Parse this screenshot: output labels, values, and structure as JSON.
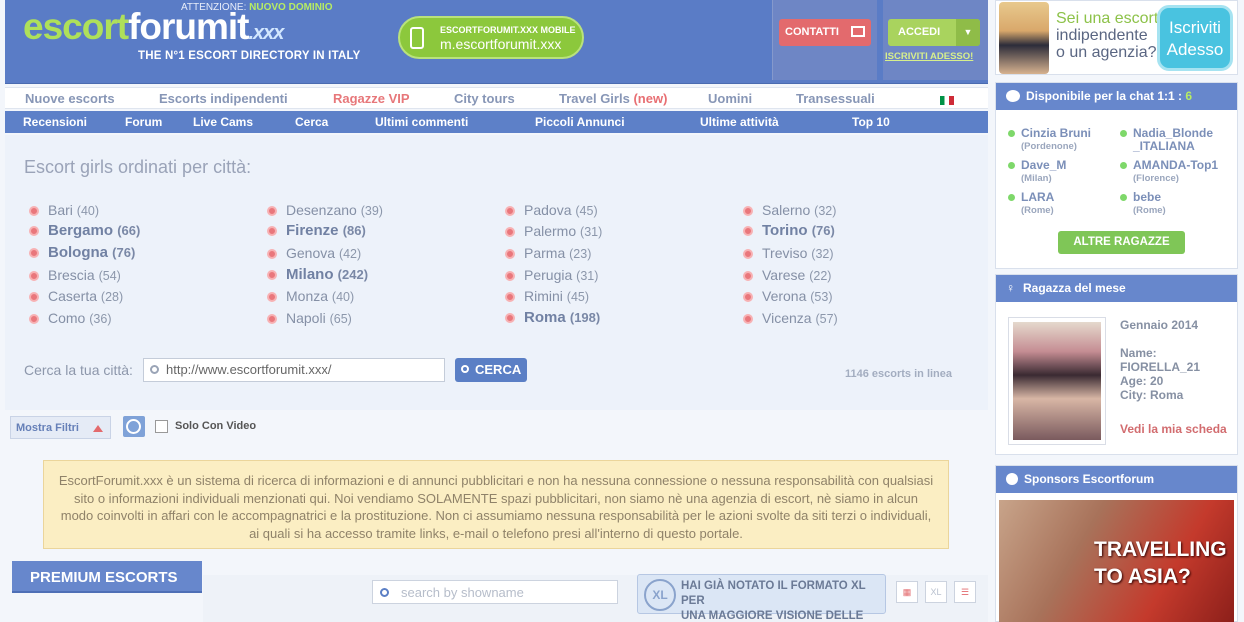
{
  "header": {
    "attention_prefix": "ATTENZIONE:",
    "attention_highlight": "NUOVO DOMINIO",
    "logo_part1": "escort",
    "logo_part2": "forumit",
    "logo_part3": ".xxx",
    "tagline": "THE N°1 ESCORT DIRECTORY IN ITALY",
    "mobile_line1": "ESCORTFORUMIT.XXX MOBILE",
    "mobile_line2": "m.escortforumit.xxx",
    "contatti": "CONTATTI",
    "accedi": "ACCEDI",
    "iscriviti": "ISCRIVITI ADESSO!"
  },
  "nav_primary": [
    {
      "label": "Nuove escorts"
    },
    {
      "label": "Escorts indipendenti"
    },
    {
      "label": "Ragazze VIP"
    },
    {
      "label": "City tours"
    },
    {
      "label": "Travel Girls",
      "badge": "(new)"
    },
    {
      "label": "Uomini"
    },
    {
      "label": "Transessuali"
    }
  ],
  "nav_secondary": [
    {
      "label": "Recensioni"
    },
    {
      "label": "Forum"
    },
    {
      "label": "Live Cams"
    },
    {
      "label": "Cerca"
    },
    {
      "label": "Ultimi commenti"
    },
    {
      "label": "Piccoli Annunci"
    },
    {
      "label": "Ultime attività"
    },
    {
      "label": "Top 10"
    }
  ],
  "cities_title": "Escort girls ordinati per città:",
  "cities": [
    {
      "name": "Bari",
      "count": "(40)"
    },
    {
      "name": "Bergamo",
      "count": "(66)"
    },
    {
      "name": "Bologna",
      "count": "(76)"
    },
    {
      "name": "Brescia",
      "count": "(54)"
    },
    {
      "name": "Caserta",
      "count": "(28)"
    },
    {
      "name": "Como",
      "count": "(36)"
    },
    {
      "name": "Desenzano",
      "count": "(39)"
    },
    {
      "name": "Firenze",
      "count": "(86)"
    },
    {
      "name": "Genova",
      "count": "(42)"
    },
    {
      "name": "Milano",
      "count": "(242)"
    },
    {
      "name": "Monza",
      "count": "(40)"
    },
    {
      "name": "Napoli",
      "count": "(65)"
    },
    {
      "name": "Padova",
      "count": "(45)"
    },
    {
      "name": "Palermo",
      "count": "(31)"
    },
    {
      "name": "Parma",
      "count": "(23)"
    },
    {
      "name": "Perugia",
      "count": "(31)"
    },
    {
      "name": "Rimini",
      "count": "(45)"
    },
    {
      "name": "Roma",
      "count": "(198)"
    },
    {
      "name": "Salerno",
      "count": "(32)"
    },
    {
      "name": "Torino",
      "count": "(76)"
    },
    {
      "name": "Treviso",
      "count": "(32)"
    },
    {
      "name": "Varese",
      "count": "(22)"
    },
    {
      "name": "Verona",
      "count": "(53)"
    },
    {
      "name": "Vicenza",
      "count": "(57)"
    }
  ],
  "search": {
    "label": "Cerca la tua città:",
    "value": "http://www.escortforumit.xxx/",
    "button": "CERCA",
    "online": "1146 escorts in linea"
  },
  "filters": {
    "label": "Mostra Filtri",
    "video_label": "Solo Con Video"
  },
  "disclaimer": "EscortForumit.xxx è un sistema di ricerca di informazioni e di annunci pubblicitari e non ha nessuna connessione o nessuna responsabilità con qualsiasi sito o informazioni individuali menzionati qui. Noi vendiamo SOLAMENTE spazi pubblicitari, non siamo nè una agenzia di escort, nè siamo in alcun modo coinvolti in affari con le accompagnatrici e la prostituzione. Non ci assumiamo nessuna responsabilità per le azioni svolte da siti terzi o individuali, ai quali si ha accesso tramite links, e-mail o telefono presi all'interno di questo portale.",
  "premium": {
    "title": "PREMIUM ESCORTS",
    "search_placeholder": "search by showname",
    "xl_badge": "XL",
    "xl_tip_line1": "HAI GIÀ NOTATO IL FORMATO XL PER",
    "xl_tip_line2": "UNA MAGGIORE VISIONE DELLE FOTO?",
    "xl_button": "XL"
  },
  "sidebar": {
    "promo_line1": "Sei una escort",
    "promo_line2": "indipendente",
    "promo_line3": "o un agenzia?",
    "promo_btn1": "Iscriviti",
    "promo_btn2": "Adesso",
    "chat_title": "Disponibile per la chat 1:1 : ",
    "chat_count": "6",
    "chat_users": [
      {
        "name": "Cinzia Bruni",
        "loc": "(Pordenone)"
      },
      {
        "name": "Nadia_Blonde",
        "name2": "_ITALIANA",
        "loc": ""
      },
      {
        "name": "Dave_M",
        "loc": "(Milan)"
      },
      {
        "name": "AMANDA-Top1",
        "loc": "(Florence)"
      },
      {
        "name": "LARA",
        "loc": "(Rome)"
      },
      {
        "name": "bebe",
        "loc": "(Rome)"
      }
    ],
    "altre": "ALTRE RAGAZZE",
    "month_title": "Ragazza del mese",
    "month_date": "Gennaio 2014",
    "month_name_label": "Name:",
    "month_name": "FIORELLA_21",
    "month_age": "Age: 20",
    "month_city": "City: Roma",
    "month_link": "Vedi la mia scheda",
    "sponsors_title": "Sponsors Escortforum",
    "sponsor_line1": "TRAVELLING",
    "sponsor_line2": "TO ASIA?"
  }
}
